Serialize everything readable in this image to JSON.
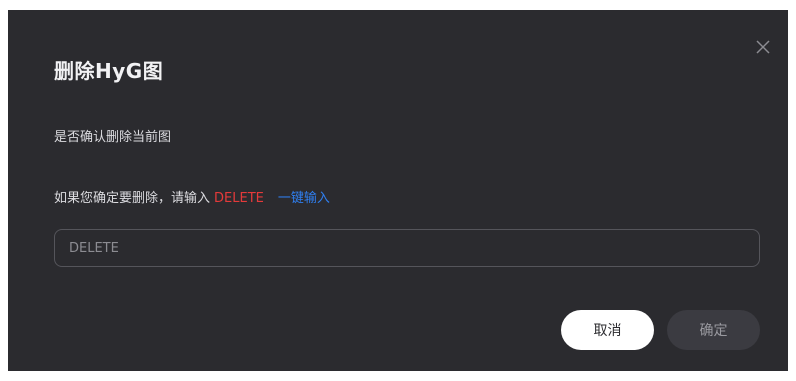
{
  "dialog": {
    "title": "删除HyG图",
    "confirm_question": "是否确认删除当前图",
    "instruction_prefix": "如果您确定要删除，请输入",
    "keyword": "DELETE",
    "quick_input_link": "一键输入",
    "input": {
      "value": "",
      "placeholder": "DELETE"
    },
    "cancel_label": "取消",
    "confirm_label": "确定",
    "close_icon": "close-icon"
  },
  "colors": {
    "dialog_bg": "#2b2b2f",
    "keyword": "#e53a3a",
    "link": "#2f7ff0",
    "cancel_bg": "#ffffff",
    "confirm_bg": "#3b3b41"
  }
}
